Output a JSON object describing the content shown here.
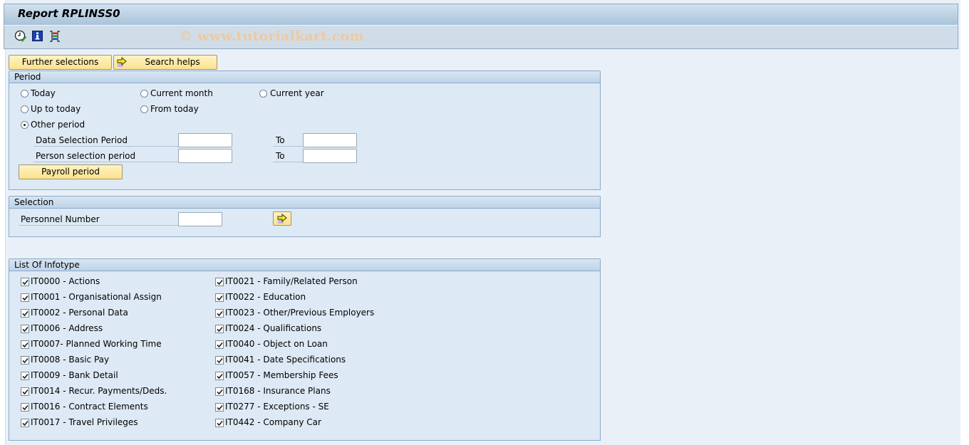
{
  "window": {
    "title": "Report RPLINSS0"
  },
  "toolbar": {
    "icons": [
      {
        "name": "execute-clock-icon",
        "label": "Execute"
      },
      {
        "name": "info-icon",
        "label": "Information"
      },
      {
        "name": "selection-options-icon",
        "label": "Selection options"
      }
    ],
    "watermark": "© www.tutorialkart.com"
  },
  "actions": {
    "further_selections": "Further selections",
    "search_helps": "Search helps"
  },
  "period": {
    "title": "Period",
    "options": [
      {
        "label": "Today",
        "selected": false
      },
      {
        "label": "Current month",
        "selected": false
      },
      {
        "label": "Current year",
        "selected": false
      },
      {
        "label": "Up to today",
        "selected": false
      },
      {
        "label": "From today",
        "selected": false
      },
      {
        "label": "Other period",
        "selected": true
      }
    ],
    "data_selection_label": "Data Selection Period",
    "data_selection_from": "",
    "data_selection_to": "",
    "person_selection_label": "Person selection period",
    "person_selection_from": "",
    "person_selection_to": "",
    "to_label": "To",
    "payroll_period_button": "Payroll period"
  },
  "selection": {
    "title": "Selection",
    "personnel_number_label": "Personnel Number",
    "personnel_number_value": ""
  },
  "infotypes": {
    "title": "List Of Infotype",
    "left": [
      {
        "label": "IT0000 - Actions",
        "checked": true
      },
      {
        "label": "IT0001 - Organisational Assign",
        "checked": true
      },
      {
        "label": "IT0002 - Personal Data",
        "checked": true
      },
      {
        "label": "IT0006 - Address",
        "checked": true
      },
      {
        "label": "IT0007-  Planned Working Time",
        "checked": true
      },
      {
        "label": "IT0008 - Basic Pay",
        "checked": true
      },
      {
        "label": "IT0009 - Bank Detail",
        "checked": true
      },
      {
        "label": "IT0014 - Recur. Payments/Deds.",
        "checked": true
      },
      {
        "label": "IT0016 - Contract Elements",
        "checked": true
      },
      {
        "label": "IT0017 - Travel Privileges",
        "checked": true
      }
    ],
    "right": [
      {
        "label": "IT0021 - Family/Related Person",
        "checked": true
      },
      {
        "label": "IT0022 - Education",
        "checked": true
      },
      {
        "label": "IT0023 - Other/Previous Employers",
        "checked": true
      },
      {
        "label": "IT0024 - Qualifications",
        "checked": true
      },
      {
        "label": "IT0040 - Object on Loan",
        "checked": true
      },
      {
        "label": "IT0041 - Date Specifications",
        "checked": true
      },
      {
        "label": "IT0057 - Membership Fees",
        "checked": true
      },
      {
        "label": "IT0168 - Insurance Plans",
        "checked": true
      },
      {
        "label": "IT0277 - Exceptions - SE",
        "checked": true
      },
      {
        "label": "IT0442 - Company Car",
        "checked": true
      }
    ]
  }
}
